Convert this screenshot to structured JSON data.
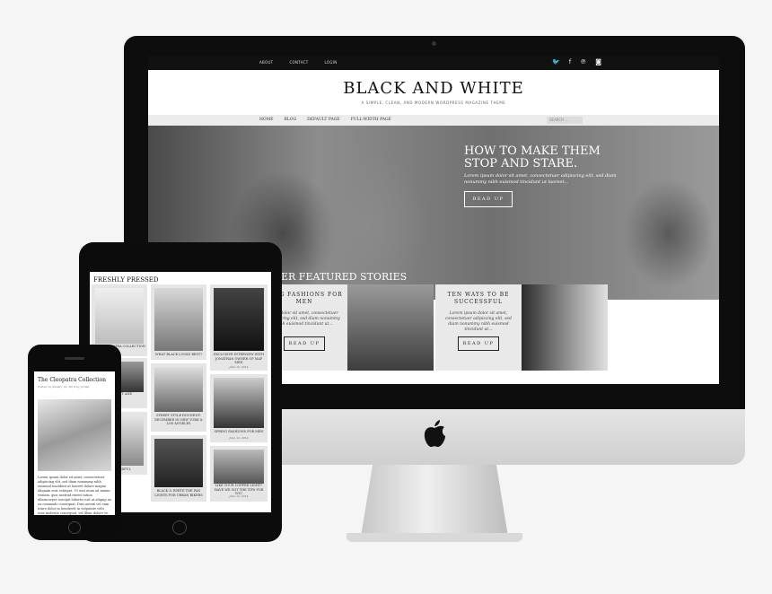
{
  "desktop": {
    "topbar": {
      "links": [
        "ABOUT",
        "CONTACT",
        "LOGIN"
      ],
      "social_icons": [
        "twitter-icon",
        "facebook-icon",
        "pinterest-icon",
        "instagram-icon"
      ]
    },
    "site_title": "BLACK AND WHITE",
    "tagline": "A SIMPLE, CLEAN, AND MODERN WORDPRESS MAGAZINE THEME",
    "nav": [
      "HOME",
      "BLOG",
      "DEFAULT PAGE",
      "FULL-WIDTH PAGE"
    ],
    "search_placeholder": "SEARCH ...",
    "hero": {
      "title": "HOW TO MAKE THEM STOP AND STARE.",
      "excerpt": "Lorem ipsum dolor sit amet, consectetuer adipiscing elit, sed diam nonummy nibh euismod tincidunt ut laoreet...",
      "button": "READ UP"
    },
    "featured_heading": "ER FEATURED STORIES",
    "cards": [
      {
        "title": "RING FASHIONS FOR MEN",
        "excerpt": "sum dolor sit amet, consectetuer adipiscing elit, sed diam nonummy nibh euismod tincidunt ut...",
        "button": "READ UP"
      },
      {
        "title": "TEN WAYS TO BE SUCCESSFUL",
        "excerpt": "Lorem ipsum dolor sit amet, consectetuer adipiscing elit, sed diam nonummy nibh euismod tincidunt ut...",
        "button": "READ UP"
      }
    ]
  },
  "tablet": {
    "heading": "FRESHLY PRESSED",
    "tiles": [
      {
        "caption": "THE CLEOPATRA COLLECTION",
        "date": ""
      },
      {
        "caption": "WHAT BLACK LOOKS BEST?",
        "date": ""
      },
      {
        "caption": "EXCLUSIVE INTERVIEW WITH JONATHAN OWNER OF MAP MEN",
        "date": "June 12, 2014"
      },
      {
        "caption": "STEP OUT AND",
        "date": ""
      },
      {
        "caption": "STREET STYLE ROUNDUP: DECEMBER IN NEW YORK & LOS ANGELES",
        "date": ""
      },
      {
        "caption": "SPRING FASHIONS FOR MEN",
        "date": "June 12, 2014"
      },
      {
        "caption": "SUCCESSFUL",
        "date": ""
      },
      {
        "caption": "BLACK & WHITE THE FAN LIGHTS FOR URBAN BIKERS",
        "date": "June 12, 2014"
      },
      {
        "caption": "LIKE YOUR COFFEE LIGHT? HAVE WE GOT THE TIPS FOR YOU",
        "date": "June 12, 2014"
      }
    ]
  },
  "phone": {
    "title": "The Cleopatra Collection",
    "meta": "Posted on January 14, 2014 by Jordan",
    "body": "Lorem ipsum dolor sit amet, consectetuer adipiscing elit, sed diam nonummy nibh euismod tincidunt ut laoreet dolore magna aliquam erat volutpat. Ut wisi enim ad minim veniam, quis nostrud exerci tation ullamcorper suscipit lobortis nisl ut aliquip ex ea commodo consequat. Duis autem vel eum iriure dolor in hendrerit in vulputate velit esse molestie consequat, vel illum dolore eu feugiat nulla facilisis at vero eros et"
  }
}
